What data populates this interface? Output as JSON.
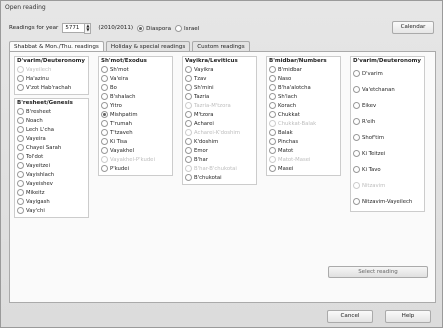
{
  "window": {
    "title": "Open reading"
  },
  "topbar": {
    "readings_label": "Readings for year",
    "year": "5771",
    "year_range": "(2010/2011)",
    "diaspora": "Diaspora",
    "israel": "Israel",
    "calendar": "Calendar"
  },
  "tabs": [
    "Shabbat & Mon./Thu. readings",
    "Holiday & special readings",
    "Custom readings"
  ],
  "columns": {
    "c1a": {
      "header": "D'varim/Deuteronomy",
      "items": [
        "Vayeilech",
        "Ha'azinu",
        "V'zot Hab'rachah"
      ]
    },
    "c1b": {
      "header": "B'resheet/Genesis",
      "items": [
        "B'resheet",
        "Noach",
        "Lech L'cha",
        "Vayeira",
        "Chayei Sarah",
        "Tol'dot",
        "Vayeitzei",
        "Vayishlach",
        "Vayeishev",
        "Mikeitz",
        "Vayigash",
        "Vay'chi"
      ]
    },
    "c2": {
      "header": "Sh'mot/Exodus",
      "items": [
        "Sh'mot",
        "Va'eira",
        "Bo",
        "B'shalach",
        "Yitro",
        "Mishpatim",
        "T'rumah",
        "T'tzaveh",
        "Ki Tisa",
        "Vayakhel",
        "Vayakhel-P'kudei",
        "P'kudei"
      ]
    },
    "c3": {
      "header": "Vayikra/Leviticus",
      "items": [
        "Vayikra",
        "Tzav",
        "Sh'mini",
        "Tazria",
        "Tazria-M'tzora",
        "M'tzora",
        "Acharei",
        "Acharei-K'doshim",
        "K'doshim",
        "Emor",
        "B'har",
        "B'har-B'chukotai",
        "B'chukotai"
      ]
    },
    "c4": {
      "header": "B'midbar/Numbers",
      "items": [
        "B'midbar",
        "Naso",
        "B'ha'alotcha",
        "Sh'lach",
        "Korach",
        "Chukkat",
        "Chukkat-Balak",
        "Balak",
        "Pinchas",
        "Matot",
        "Matot-Masei",
        "Masei"
      ]
    },
    "c5": {
      "header": "D'varim/Deuteronomy",
      "items": [
        "D'varim",
        "Va'etchanan",
        "Eikev",
        "R'eih",
        "Shof'tim",
        "Ki Teitzei",
        "Ki Tavo",
        "Nitzavim",
        "Nitzavim-Vayeilech"
      ]
    }
  },
  "buttons": {
    "select": "Select reading",
    "cancel": "Cancel",
    "help": "Help"
  }
}
